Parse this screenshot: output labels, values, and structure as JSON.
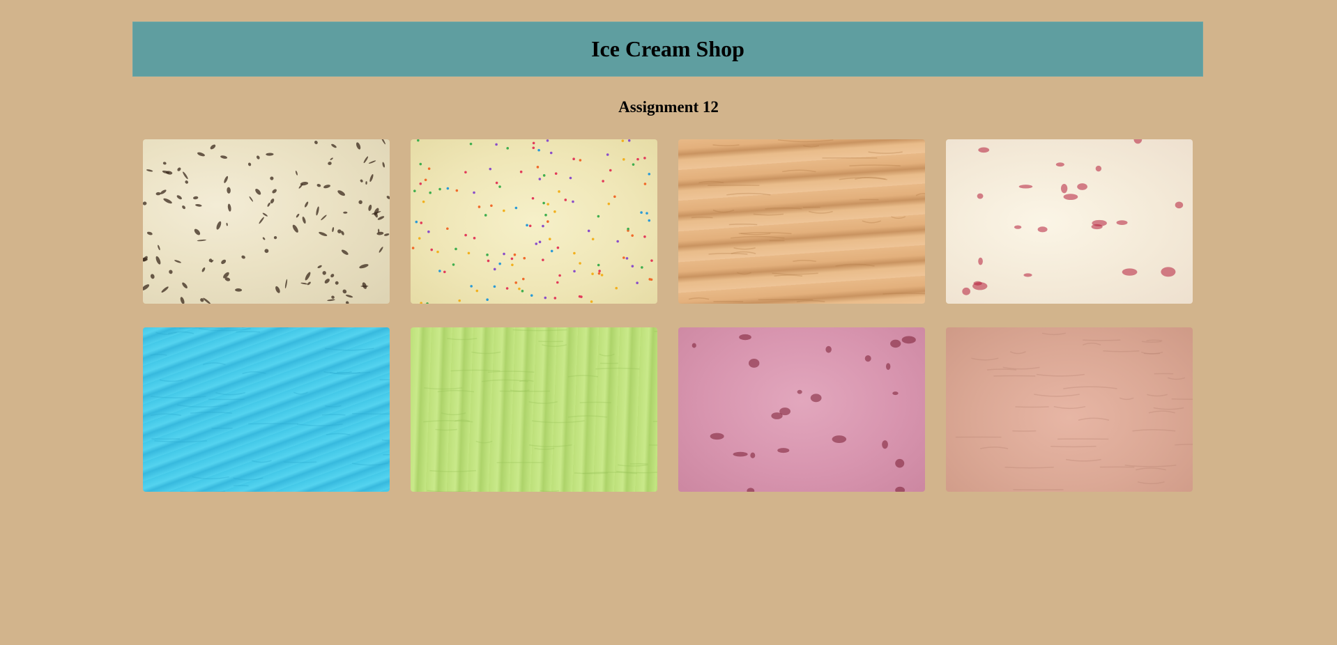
{
  "header": {
    "title": "Ice Cream Shop"
  },
  "subtitle": "Assignment 12",
  "gallery": {
    "images": [
      {
        "name": "cookies-and-cream-image",
        "texture": "t-cookies",
        "accent": "#3b2a1c"
      },
      {
        "name": "birthday-cake-sprinkles-image",
        "texture": "t-birthday",
        "accent": "#e23b5a"
      },
      {
        "name": "caramel-image",
        "texture": "t-caramel",
        "accent": "#b37c49"
      },
      {
        "name": "berry-swirl-image",
        "texture": "t-berry",
        "accent": "#b51f3c"
      },
      {
        "name": "blue-ice-cream-image",
        "texture": "t-blue",
        "accent": "#2aa9cf"
      },
      {
        "name": "lime-sherbet-image",
        "texture": "t-lime",
        "accent": "#97c25a"
      },
      {
        "name": "cherry-ice-cream-image",
        "texture": "t-pink",
        "accent": "#7a1e33"
      },
      {
        "name": "strawberry-chocolate-image",
        "texture": "t-choc",
        "accent": "#b88372"
      }
    ]
  },
  "colors": {
    "background": "#d2b48c",
    "header": "#5f9ea0"
  }
}
